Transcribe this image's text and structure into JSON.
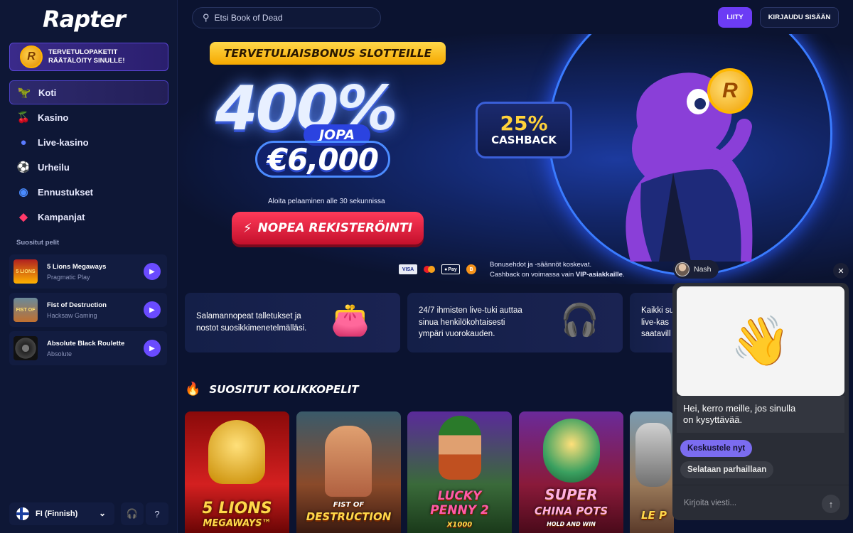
{
  "brand": {
    "logo_text": "Rapter",
    "coin_letter": "R"
  },
  "sidebar": {
    "welcome": {
      "line1": "TERVETULOPAKETIT",
      "line2": "RÄÄTÄLÖITY SINULLE!"
    },
    "items": [
      {
        "label": "Koti",
        "icon": "dino-icon",
        "active": true
      },
      {
        "label": "Kasino",
        "icon": "cherry-icon"
      },
      {
        "label": "Live-kasino",
        "icon": "chip-icon"
      },
      {
        "label": "Urheilu",
        "icon": "soccer-ball-icon"
      },
      {
        "label": "Ennustukset",
        "icon": "trend-icon"
      },
      {
        "label": "Kampanjat",
        "icon": "gem-icon"
      }
    ],
    "popular_label": "Suositut pelit",
    "popular": [
      {
        "title": "5 Lions Megaways",
        "provider": "Pragmatic Play",
        "thumb": "5 LIONS"
      },
      {
        "title": "Fist of Destruction",
        "provider": "Hacksaw Gaming",
        "thumb": "FIST OF"
      },
      {
        "title": "Absolute Black Roulette",
        "provider": "Absolute",
        "thumb": ""
      }
    ],
    "language": "FI (Finnish)"
  },
  "header": {
    "search_placeholder": "Etsi Book of Dead",
    "join_label": "LIITY",
    "login_label": "KIRJAUDU SISÄÄN"
  },
  "hero": {
    "tag": "TERVETULIAISBONUS SLOTTEILLE",
    "percent": "400%",
    "jopa": "JOPA",
    "amount": "€6,000",
    "start_note": "Aloita pelaaminen alle 30 sekunnissa",
    "cta": "NOPEA REKISTERÖINTI",
    "payments": [
      "VISA",
      "",
      "Pay",
      "B"
    ],
    "disclaimer_line1": "Bonusehdot ja -säännöt koskevat.",
    "disclaimer_line2_prefix": "Cashback on voimassa vain ",
    "disclaimer_line2_bold": "VIP-asiakkaille",
    "disclaimer_line2_suffix": ".",
    "cashback_pct": "25%",
    "cashback_label": "CASHBACK",
    "mascot_coin": "R"
  },
  "features": [
    {
      "text_line1": "Salamannopeat talletukset ja",
      "text_line2": "nostot suosikkimenetelmälläsi.",
      "text_line3": ""
    },
    {
      "text_line1": "24/7 ihmisten live-tuki auttaa",
      "text_line2": "sinua henkilökohtaisesti",
      "text_line3": "ympäri vuorokauden."
    },
    {
      "text_line1": "Kaikki su",
      "text_line2": "live-kas",
      "text_line3": "saatavill"
    }
  ],
  "slots": {
    "title": "SUOSITUT KOLIKKOPELIT",
    "games": [
      {
        "line1": "5 LIONS",
        "line2": "MEGAWAYS™"
      },
      {
        "line1": "FIST OF",
        "line2": "DESTRUCTION"
      },
      {
        "line1": "LUCKY",
        "line2": "PENNY 2",
        "line3": "X1000"
      },
      {
        "line1": "SUPER",
        "line2": "CHINA POTS",
        "line3": "HOLD AND WIN"
      },
      {
        "line1": "LE P"
      }
    ]
  },
  "chat": {
    "agent_name": "Nash",
    "message_line1": "Hei, kerro meille, jos sinulla",
    "message_line2": "on kysyttävää.",
    "option_primary": "Keskustele nyt",
    "option_secondary": "Selataan parhaillaan",
    "input_placeholder": "Kirjoita viesti..."
  }
}
